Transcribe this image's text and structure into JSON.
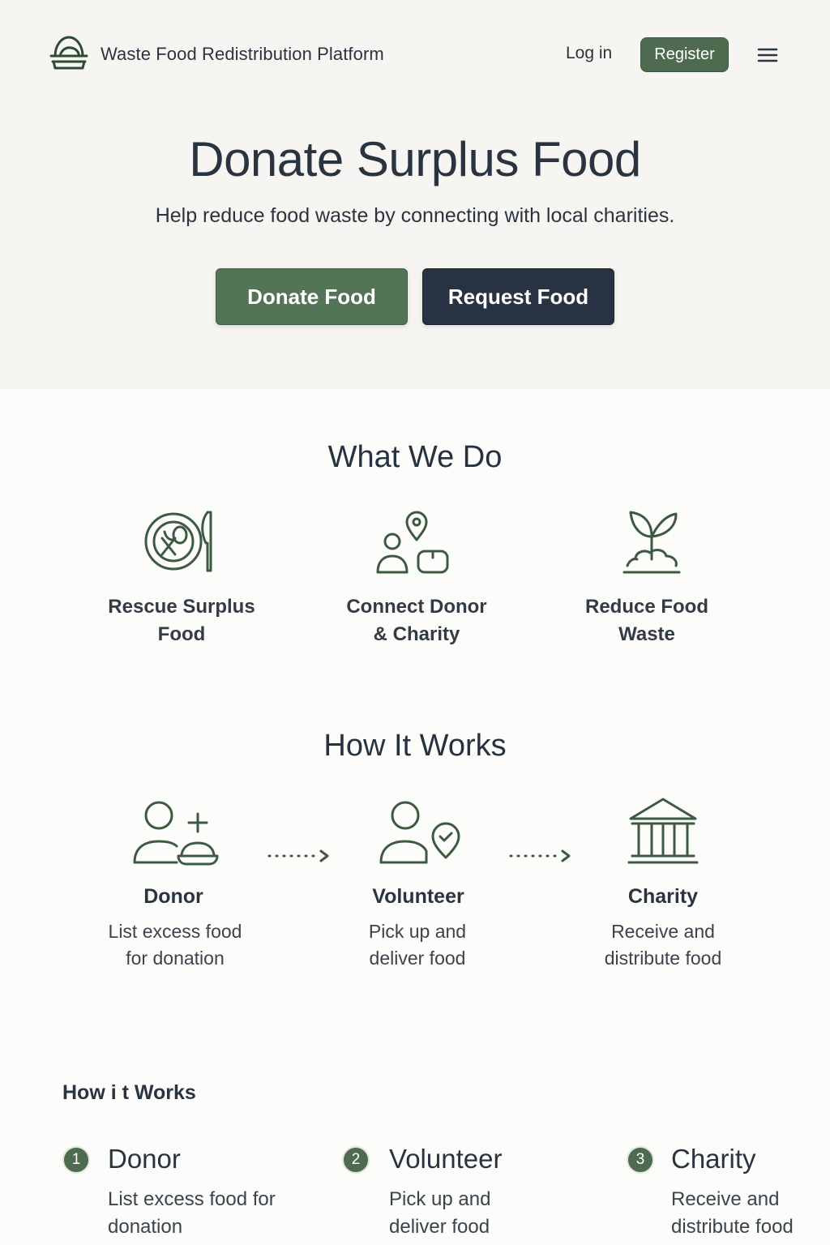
{
  "header": {
    "brand": "Waste Food Redistribution Platform",
    "login_label": "Log in",
    "register_label": "Register"
  },
  "hero": {
    "title": "Donate Surplus Food",
    "subtitle": "Help reduce food waste by connecting with local charities.",
    "donate_label": "Donate Food",
    "request_label": "Request Food"
  },
  "what_we_do": {
    "title": "What We Do",
    "items": [
      {
        "label_line1": "Rescue Surplus",
        "label_line2": "Food",
        "icon": "plate-utensils-icon"
      },
      {
        "label_line1": "Connect Donor",
        "label_line2": "& Charity",
        "icon": "people-location-icon"
      },
      {
        "label_line1": "Reduce Food",
        "label_line2": "Waste",
        "icon": "sprout-icon"
      }
    ]
  },
  "how_it_works": {
    "title": "How It Works",
    "steps": [
      {
        "name": "Donor",
        "desc_line1": "List excess food",
        "desc_line2": "for donation",
        "icon": "donor-add-icon"
      },
      {
        "name": "Volunteer",
        "desc_line1": "Pick up and",
        "desc_line2": "deliver food",
        "icon": "volunteer-check-icon"
      },
      {
        "name": "Charity",
        "desc_line1": "Receive and",
        "desc_line2": "distribute food",
        "icon": "charity-building-icon"
      }
    ]
  },
  "how_it_works_list": {
    "title": "How i t Works",
    "steps": [
      {
        "number": "1",
        "name": "Donor",
        "desc_line1": "List excess food for",
        "desc_line2": "donation"
      },
      {
        "number": "2",
        "name": "Volunteer",
        "desc_line1": "Pick up and",
        "desc_line2": "deliver food"
      },
      {
        "number": "3",
        "name": "Charity",
        "desc_line1": "Receive and",
        "desc_line2": "distribute food"
      }
    ]
  },
  "colors": {
    "accent_green": "#4e6b50",
    "dark_navy": "#273342",
    "text": "#2a3441",
    "icon_stroke": "#3d5a40"
  }
}
